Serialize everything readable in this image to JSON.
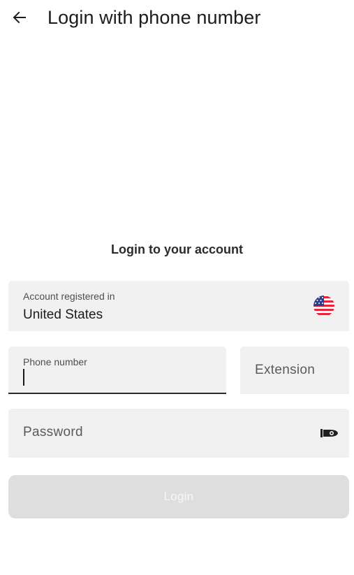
{
  "appbar": {
    "back_icon": "arrow-left-icon",
    "title": "Login with phone number"
  },
  "form": {
    "section_title": "Login to your account",
    "region": {
      "label": "Account registered in",
      "value": "United States",
      "flag_icon": "us-flag-icon"
    },
    "phone": {
      "label": "Phone number",
      "value": ""
    },
    "extension": {
      "placeholder": "Extension"
    },
    "password": {
      "placeholder": "Password",
      "toggle_icon": "visibility-toggle-icon"
    },
    "login_label": "Login"
  },
  "colors": {
    "field_bg": "#f1f1f1",
    "button_disabled_bg": "#dedede",
    "button_disabled_text": "#f7f7f7",
    "focus_underline": "#2a2a2a",
    "flag_red": "#e8243a",
    "flag_blue": "#2c3f8f"
  }
}
